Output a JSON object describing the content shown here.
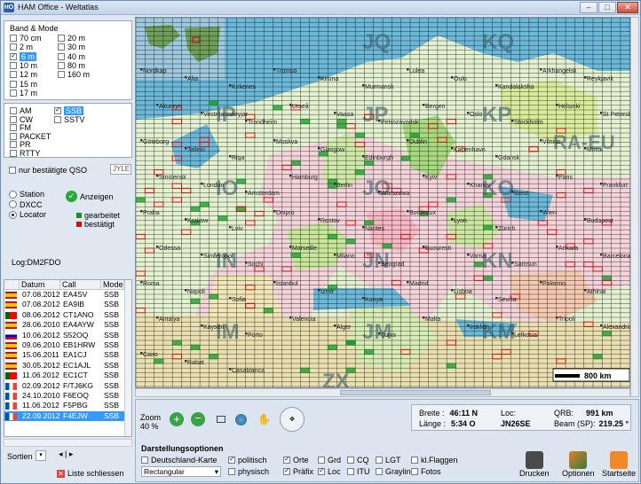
{
  "titlebar": {
    "app_icon": "ho-icon",
    "title": "HAM Office - Weltatlas",
    "minimize": "–",
    "maximize": "□",
    "close": "✕"
  },
  "band_mode": {
    "title": "Band & Mode",
    "bands_left": [
      {
        "label": "70 cm",
        "checked": false
      },
      {
        "label": "2 m",
        "checked": false
      },
      {
        "label": "6 m",
        "checked": true,
        "selected": true
      },
      {
        "label": "10 m",
        "checked": false
      },
      {
        "label": "12 m",
        "checked": false
      },
      {
        "label": "15 m",
        "checked": false
      },
      {
        "label": "17 m",
        "checked": false
      }
    ],
    "bands_right": [
      {
        "label": "20 m",
        "checked": false
      },
      {
        "label": "30 m",
        "checked": false
      },
      {
        "label": "40 m",
        "checked": false
      },
      {
        "label": "80 m",
        "checked": false
      },
      {
        "label": "160 m",
        "checked": false
      }
    ]
  },
  "modes": {
    "left": [
      {
        "label": "AM",
        "checked": false
      },
      {
        "label": "CW",
        "checked": false
      },
      {
        "label": "FM",
        "checked": false
      },
      {
        "label": "PACKET",
        "checked": false
      },
      {
        "label": "PR",
        "checked": false
      },
      {
        "label": "RTTY",
        "checked": false
      }
    ],
    "right": [
      {
        "label": "SSB",
        "checked": true,
        "selected": true
      },
      {
        "label": "SSTV",
        "checked": false
      }
    ]
  },
  "confirmed_only": {
    "label": "nur bestätigte QSO",
    "qsl_placeholder": "QSL",
    "qsl_value": "JYLE"
  },
  "view": {
    "options": [
      {
        "label": "Station",
        "on": false
      },
      {
        "label": "DXCC",
        "on": false
      },
      {
        "label": "Locator",
        "on": true
      }
    ],
    "show_label": "Anzeigen",
    "legend": [
      {
        "label": "gearbeitet",
        "color": "#1f8f2a"
      },
      {
        "label": "bestätigt",
        "color": "#cc1111"
      }
    ],
    "log": "Log:DM2FDO"
  },
  "log_table": {
    "headers": [
      "Datum",
      "Call",
      "Mode"
    ],
    "rows": [
      {
        "flag": "es",
        "date": "07.08.2012",
        "call": "EA4SV",
        "mode": "SSB"
      },
      {
        "flag": "es",
        "date": "07.08.2012",
        "call": "EA9IB",
        "mode": "SSB"
      },
      {
        "flag": "pt",
        "date": "08.06.2012",
        "call": "CT1ANO",
        "mode": "SSB"
      },
      {
        "flag": "es",
        "date": "28.06.2010",
        "call": "EA4AYW",
        "mode": "SSB"
      },
      {
        "flag": "si",
        "date": "10.06.2012",
        "call": "S52OQ",
        "mode": "SSB"
      },
      {
        "flag": "es",
        "date": "09.06.2010",
        "call": "EB1HRW",
        "mode": "SSB"
      },
      {
        "flag": "es",
        "date": "15.06.2011",
        "call": "EA1CJ",
        "mode": "SSB"
      },
      {
        "flag": "es",
        "date": "30.05.2012",
        "call": "EC1AJL",
        "mode": "SSB"
      },
      {
        "flag": "pt",
        "date": "11.06.2012",
        "call": "EC1CT",
        "mode": "SSB"
      },
      {
        "flag": "fr",
        "date": "02.09.2012",
        "call": "F/TJ6KG",
        "mode": "SSB"
      },
      {
        "flag": "fr",
        "date": "24.10.2010",
        "call": "F6EOQ",
        "mode": "SSB"
      },
      {
        "flag": "fr",
        "date": "11.06.2012",
        "call": "F5PBG",
        "mode": "SSB"
      },
      {
        "flag": "fr",
        "date": "22.09.2012",
        "call": "F4EJW",
        "mode": "SSB",
        "selected": true
      }
    ],
    "nav_prev": "◂",
    "nav_next": "▸",
    "sort_label": "Sortien",
    "close_list": "Liste schliessen"
  },
  "map": {
    "grid_labels": [
      {
        "t": "JQ"
      },
      {
        "t": "KQ"
      },
      {
        "t": "IP"
      },
      {
        "t": "JP"
      },
      {
        "t": "KP"
      },
      {
        "t": "IO"
      },
      {
        "t": "JO"
      },
      {
        "t": "KO"
      },
      {
        "t": "IN"
      },
      {
        "t": "JN"
      },
      {
        "t": "KN"
      },
      {
        "t": "IM"
      },
      {
        "t": "JM"
      },
      {
        "t": "KM"
      },
      {
        "t": "ZX"
      },
      {
        "t": "RA-EU"
      }
    ],
    "cities": [
      "Nordkap",
      "Alta",
      "Kirkenes",
      "Tromsö",
      "Kiruna",
      "Murmansk",
      "Lulea",
      "Oulu",
      "Kandalaksha",
      "Arkhangelsk",
      "Reykjavik",
      "Akureyri",
      "Vestmannaeyjar",
      "Trondheim",
      "Umeå",
      "Vaasa",
      "Petrozavodsk",
      "Bergen",
      "Oslo",
      "Stockholm",
      "Helsinki",
      "St Petersburg",
      "Göteborg",
      "Tallinn",
      "Riga",
      "Moskva",
      "Glasgow",
      "Edinburgh",
      "Dublin",
      "København",
      "Gdansk",
      "Vilnius",
      "Minsk",
      "Smolensk",
      "London",
      "Amsterdam",
      "Hamburg",
      "Berlin",
      "Warszawa",
      "Kyiv",
      "Kharkiv",
      "Brest",
      "Paris",
      "Frankfurt",
      "Praha",
      "Krakow",
      "Lviv",
      "Dnipro",
      "Rostov",
      "Nantes",
      "Bordeaux",
      "Lyon",
      "Zürich",
      "Wien",
      "Budapest",
      "Odessa",
      "Simferopol",
      "Sochi",
      "Marseille",
      "Milano",
      "Beograd",
      "Bucuresti",
      "Varna",
      "Samsun",
      "Ankara",
      "Barcelona",
      "Roma",
      "Napoli",
      "Sofia",
      "Istanbul",
      "Izmir",
      "Konya",
      "Madrid",
      "Lisboa",
      "Sevilla",
      "Palermo",
      "Athinai",
      "Antalya",
      "Kayseri",
      "Porto",
      "Valencia",
      "Alger",
      "Tunis",
      "Malta",
      "Iraklion",
      "Lefkosia",
      "Tripoli",
      "Alexandria",
      "Cairo",
      "Rabat",
      "Casablanca"
    ],
    "scale_label": "800 km",
    "working_color": "#1f8f2a",
    "confirmed_color": "#cc1111"
  },
  "status": {
    "zoom_label": "Zoom",
    "zoom_value": "40 %",
    "breite_label": "Breite :",
    "breite_value": "46:11 N",
    "laenge_label": "Länge :",
    "laenge_value": "5:34 O",
    "loc_label": "Loc:",
    "loc_value": "JN26SE",
    "qrb_label": "QRB:",
    "qrb_value": "991 km",
    "beam_label": "Beam (SP):",
    "beam_value": "219.25 °"
  },
  "display_options": {
    "title": "Darstellungsoptionen",
    "projection": "Rectangular",
    "checks": [
      {
        "label": "Deutschland-Karte",
        "checked": false
      },
      {
        "label": "politisch",
        "checked": true
      },
      {
        "label": "physisch",
        "checked": false
      },
      {
        "label": "Orte",
        "checked": true
      },
      {
        "label": "Präfix",
        "checked": true
      },
      {
        "label": "Grd",
        "checked": false
      },
      {
        "label": "Loc",
        "checked": true
      },
      {
        "label": "CQ",
        "checked": false
      },
      {
        "label": "ITU",
        "checked": false
      },
      {
        "label": "LGT",
        "checked": false
      },
      {
        "label": "Grayline",
        "checked": false
      },
      {
        "label": "kl.Flaggen",
        "checked": false
      },
      {
        "label": "Fotos",
        "checked": false
      }
    ],
    "print": "Drucken",
    "options": "Optionen",
    "start": "Startseite"
  }
}
